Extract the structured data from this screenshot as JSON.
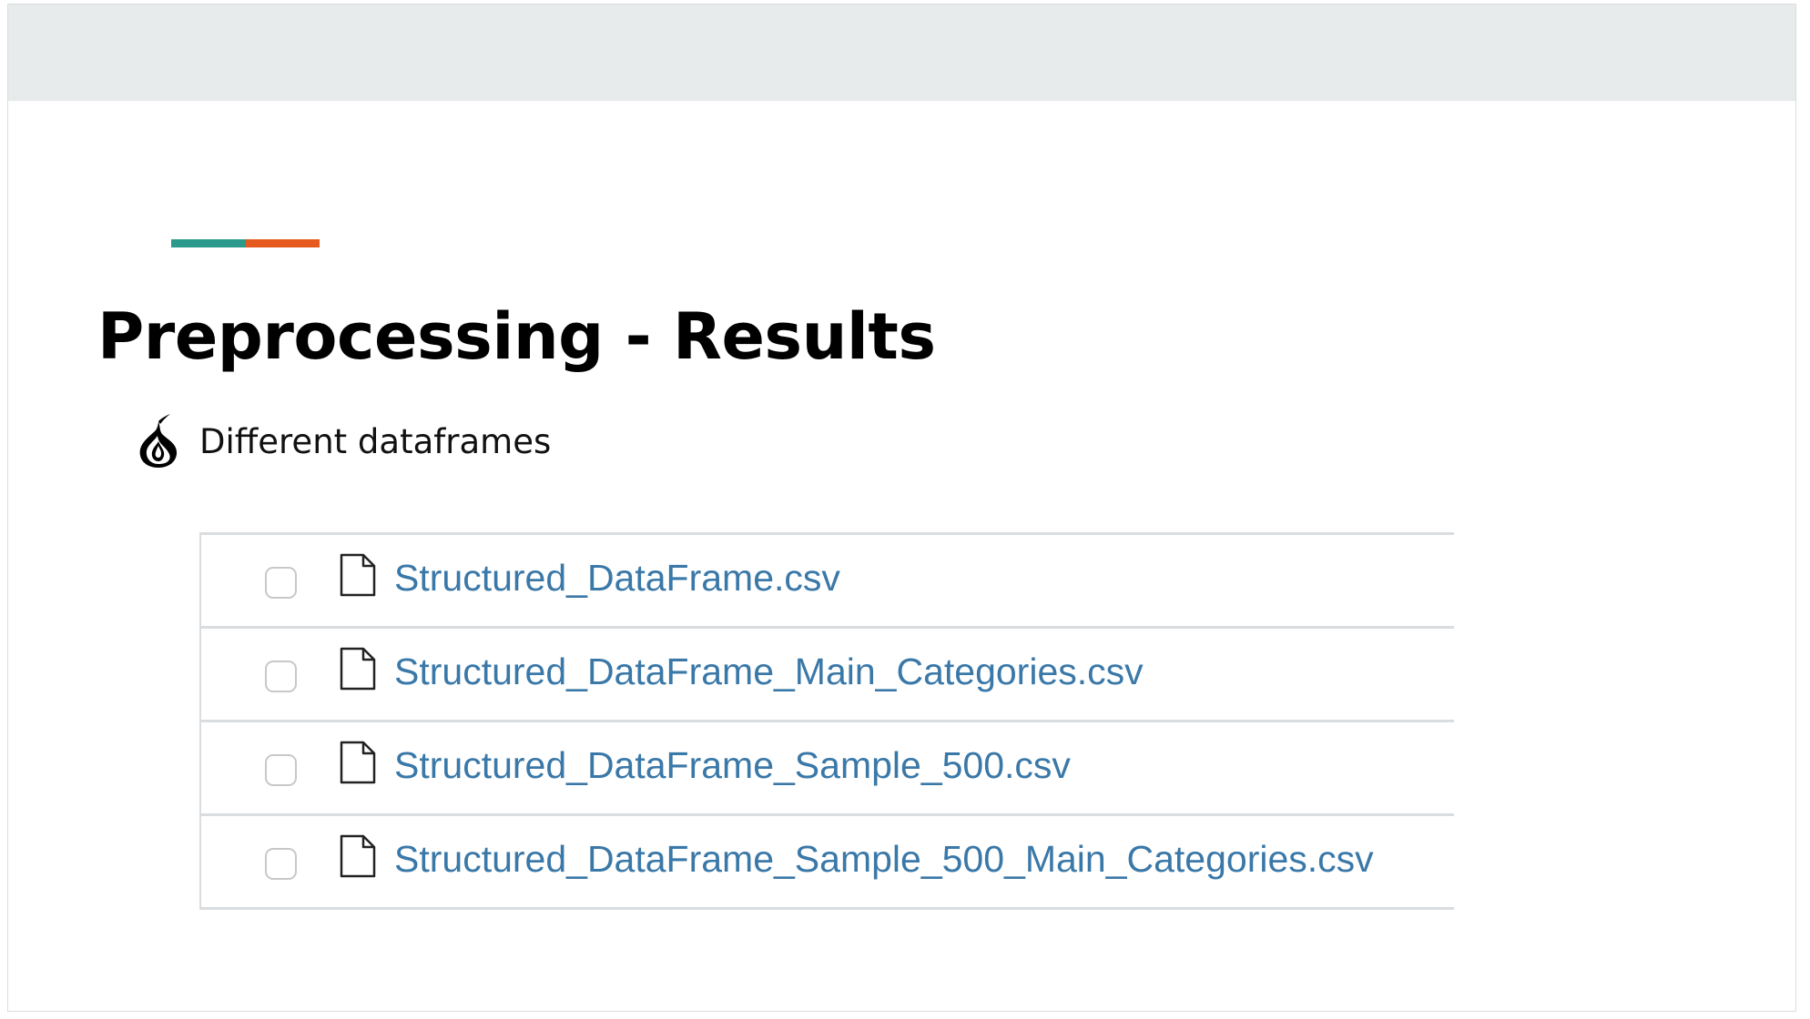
{
  "slide": {
    "title": "Preprocessing - Results",
    "bullet": "Different dataframes",
    "bullet_icon": "onion-icon",
    "accent_colors": [
      "#2b9a8c",
      "#e75a1f"
    ]
  },
  "files": [
    {
      "name": "Structured_DataFrame.csv",
      "icon": "file-icon"
    },
    {
      "name": "Structured_DataFrame_Main_Categories.csv",
      "icon": "file-icon"
    },
    {
      "name": "Structured_DataFrame_Sample_500.csv",
      "icon": "file-icon"
    },
    {
      "name": "Structured_DataFrame_Sample_500_Main_Categories.csv",
      "icon": "file-icon"
    }
  ],
  "colors": {
    "link": "#3a78a8",
    "header_band": "#e8ebec",
    "divider": "#dadddf"
  }
}
